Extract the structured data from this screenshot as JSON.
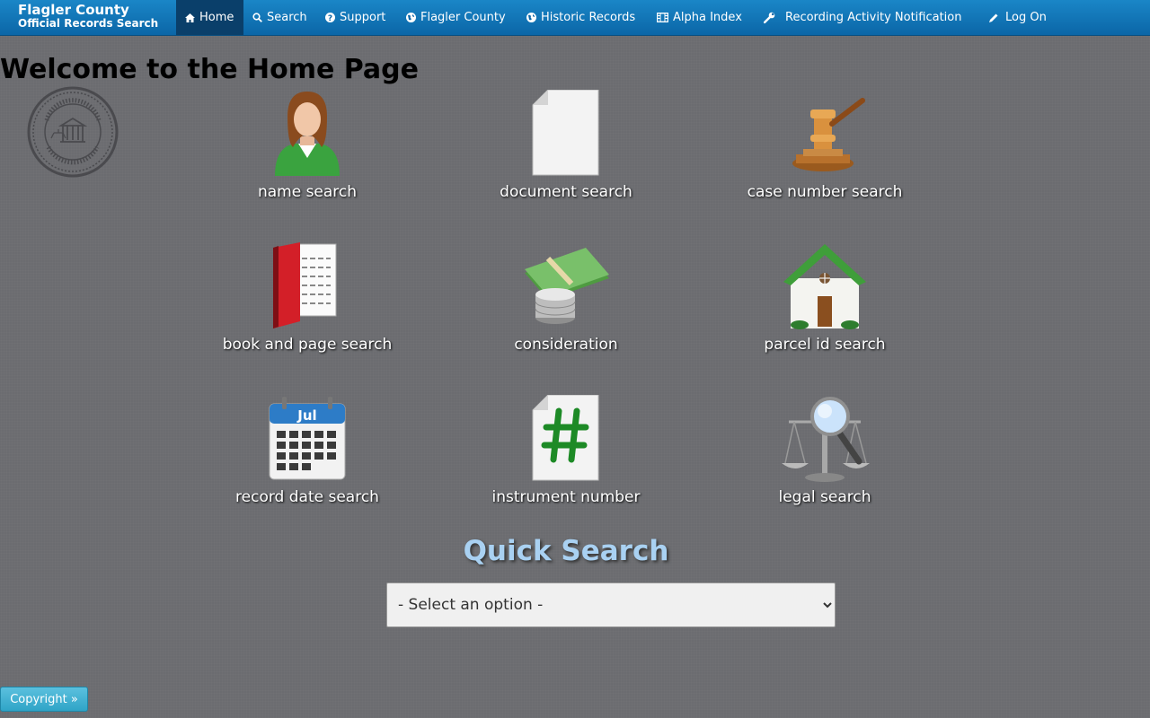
{
  "brand": {
    "line1": "Flagler County",
    "line2": "Official Records Search"
  },
  "nav": [
    {
      "label": "Home",
      "icon": "home-icon"
    },
    {
      "label": "Search",
      "icon": "search-icon"
    },
    {
      "label": "Support",
      "icon": "question-circle-icon"
    },
    {
      "label": "Flagler County",
      "icon": "globe-icon"
    },
    {
      "label": "Historic Records",
      "icon": "globe-icon"
    },
    {
      "label": "Alpha Index",
      "icon": "film-icon"
    },
    {
      "label": "Recording Activity Notification",
      "icon": "wrench-icon"
    },
    {
      "label": "Log On",
      "icon": "pencil-icon"
    }
  ],
  "page": {
    "title": "Welcome to the Home Page",
    "seal_icon": "county-seal-icon"
  },
  "tiles": [
    {
      "label": "name search",
      "icon": "person-icon"
    },
    {
      "label": "document search",
      "icon": "blank-document-icon"
    },
    {
      "label": "case number search",
      "icon": "gavel-icon"
    },
    {
      "label": "book and page search",
      "icon": "book-icon"
    },
    {
      "label": "consideration",
      "icon": "money-icon"
    },
    {
      "label": "parcel id search",
      "icon": "house-icon"
    },
    {
      "label": "record date search",
      "icon": "calendar-icon"
    },
    {
      "label": "instrument number",
      "icon": "hash-document-icon"
    },
    {
      "label": "legal search",
      "icon": "scales-magnifier-icon"
    }
  ],
  "calendar_month": "Jul",
  "quick_search": {
    "title": "Quick Search",
    "selected": "- Select an option -"
  },
  "footer": {
    "copyright_label": "Copyright »"
  },
  "colors": {
    "nav_bg": "#0b66a7",
    "active_nav": "#0a3f6a",
    "page_bg": "#6b6c70",
    "quick_title": "#a9d1f2",
    "copyright_btn": "#2fa4c7"
  }
}
